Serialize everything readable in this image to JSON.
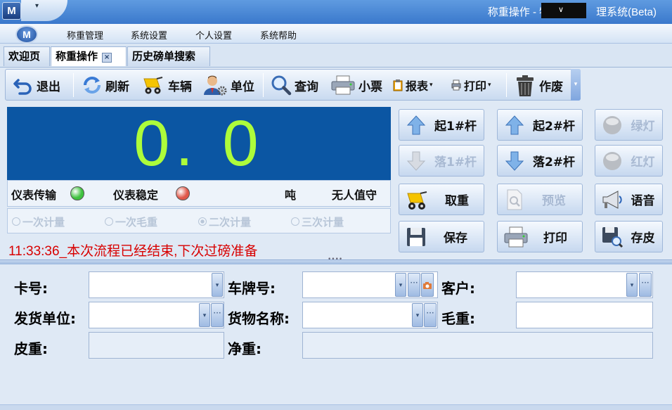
{
  "window": {
    "title": "称重操作 - 物",
    "title_suffix": "理系统(Beta)",
    "logo": "M",
    "quick_access": "▾"
  },
  "menu": {
    "orb": "M",
    "items": [
      "称重管理",
      "系统设置",
      "个人设置",
      "系统帮助"
    ]
  },
  "tabs": [
    {
      "label": "欢迎页"
    },
    {
      "label": "称重操作",
      "active": true,
      "close": "×"
    },
    {
      "label": "历史磅单搜索"
    }
  ],
  "toolbar": {
    "exit": "退出",
    "refresh": "刷新",
    "vehicle": "车辆",
    "unit": "单位",
    "query": "查询",
    "ticket": "小票",
    "report": "报表",
    "print": "打印",
    "void": "作废",
    "dropdown": "▾"
  },
  "display": {
    "weight": "0. 0",
    "unit": "吨",
    "unattended": "无人值守"
  },
  "status": {
    "meter_transmit": "仪表传输",
    "meter_stable": "仪表稳定",
    "transmit_color": "#3fc23f",
    "stable_color": "#e0584a"
  },
  "modes": [
    {
      "label": "一次计量",
      "selected": false
    },
    {
      "label": "一次毛重",
      "selected": false
    },
    {
      "label": "二次计量",
      "selected": true
    },
    {
      "label": "三次计量",
      "selected": false
    }
  ],
  "message": "11:33:36_本次流程已经结束,下次过磅准备",
  "controls": {
    "raise1": "起1#杆",
    "lower1": "落1#杆",
    "raise2": "起2#杆",
    "lower2": "落2#杆",
    "green_light": "绿灯",
    "red_light": "红灯",
    "fetch_weight": "取重",
    "preview": "预览",
    "voice": "语音",
    "save": "保存",
    "print": "打印",
    "store_tare": "存皮"
  },
  "form": {
    "card_no": {
      "label": "卡号:",
      "value": ""
    },
    "plate_no": {
      "label": "车牌号:",
      "value": ""
    },
    "customer": {
      "label": "客户:",
      "value": ""
    },
    "shipper": {
      "label": "发货单位:",
      "value": ""
    },
    "goods_name": {
      "label": "货物名称:",
      "value": ""
    },
    "gross": {
      "label": "毛重:",
      "value": ""
    },
    "tare": {
      "label": "皮重:",
      "value": ""
    },
    "net": {
      "label": "净重:",
      "value": ""
    },
    "dropdown_glyph": "▾",
    "ellipsis": "···"
  }
}
